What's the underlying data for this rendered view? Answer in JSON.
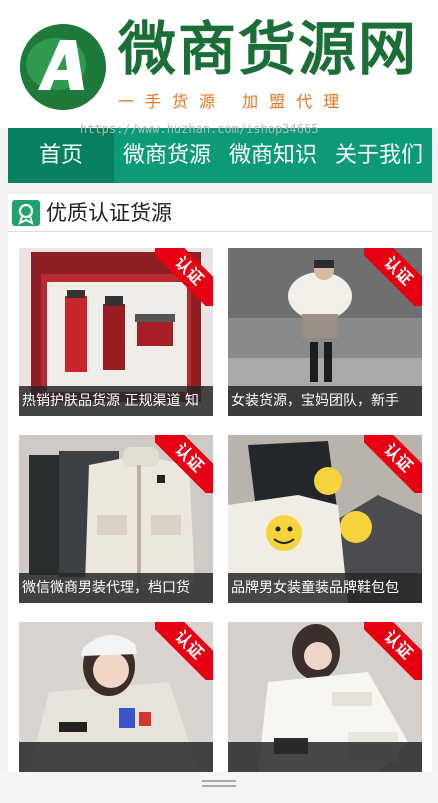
{
  "header": {
    "logo_letter": "A",
    "site_title": "微商货源网",
    "slogan": "一手货源 加盟代理",
    "watermark": "https://www.huzhan.com/ishop34665"
  },
  "nav": {
    "items": [
      {
        "label": "首页",
        "active": true
      },
      {
        "label": "微商货源",
        "active": false
      },
      {
        "label": "微商知识",
        "active": false
      },
      {
        "label": "关于我们",
        "active": false
      }
    ]
  },
  "section": {
    "title": "优质认证货源",
    "icon": "badge-icon"
  },
  "colors": {
    "brand_green": "#0c9a78",
    "logo_green": "#1b6e36",
    "slogan_orange": "#e8731a",
    "badge_red": "#e60012"
  },
  "products": [
    {
      "caption": "热销护肤品货源 正规渠道 知",
      "badge": "认证"
    },
    {
      "caption": "女装货源，宝妈团队，新手",
      "badge": "认证"
    },
    {
      "caption": "微信微商男装代理，档口货",
      "badge": "认证"
    },
    {
      "caption": "品牌男女装童装品牌鞋包包",
      "badge": "认证"
    },
    {
      "caption": "",
      "badge": "认证"
    },
    {
      "caption": "",
      "badge": "认证"
    }
  ]
}
